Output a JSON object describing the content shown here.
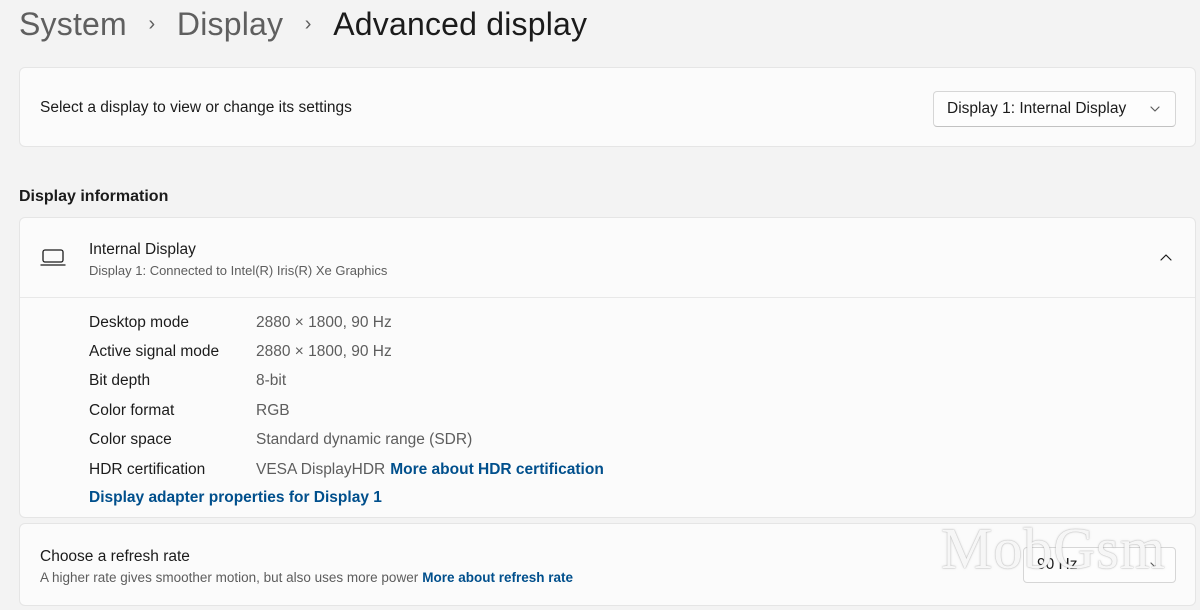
{
  "breadcrumb": {
    "items": [
      "System",
      "Display",
      "Advanced display"
    ],
    "separator": "›"
  },
  "display_select": {
    "label": "Select a display to view or change its settings",
    "selected": "Display 1: Internal Display"
  },
  "display_info": {
    "section_title": "Display information",
    "name": "Internal Display",
    "subtitle": "Display 1: Connected to Intel(R) Iris(R) Xe Graphics",
    "rows": [
      {
        "key": "Desktop mode",
        "value": "2880 × 1800, 90 Hz"
      },
      {
        "key": "Active signal mode",
        "value": "2880 × 1800, 90 Hz"
      },
      {
        "key": "Bit depth",
        "value": "8-bit"
      },
      {
        "key": "Color format",
        "value": "RGB"
      },
      {
        "key": "Color space",
        "value": "Standard dynamic range (SDR)"
      },
      {
        "key": "HDR certification",
        "value": "VESA DisplayHDR",
        "link": "More about HDR certification"
      }
    ],
    "adapter_link": "Display adapter properties for Display 1"
  },
  "refresh": {
    "title": "Choose a refresh rate",
    "subtitle": "A higher rate gives smoother motion, but also uses more power",
    "link": "More about refresh rate",
    "selected": "90 Hz"
  },
  "watermark": "MobGsm",
  "icons": {
    "separator": "chevron-right-icon",
    "dropdown": "chevron-down-icon",
    "device": "laptop-icon",
    "collapse": "chevron-up-icon"
  },
  "colors": {
    "background": "#f3f3f3",
    "card": "#fbfbfb",
    "link": "#004f8c",
    "secondary_text": "#5d5d5d"
  }
}
